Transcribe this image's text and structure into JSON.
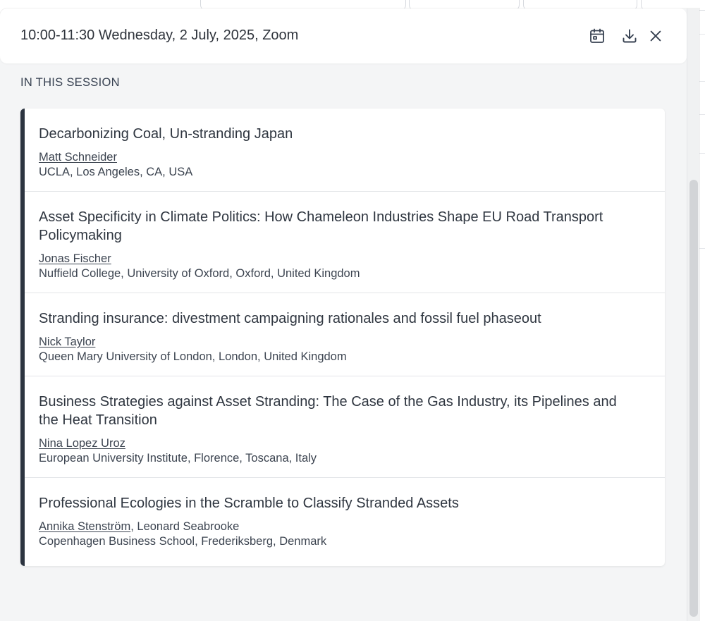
{
  "modal": {
    "title": "10:00-11:30 Wednesday, 2 July, 2025, Zoom",
    "section_label": "IN THIS SESSION",
    "icons": {
      "calendar": "calendar-icon",
      "download": "download-icon",
      "close": "close-icon"
    }
  },
  "colors": {
    "accent_bar": "#2c3440",
    "text": "#374151",
    "background": "#f4f5f6"
  },
  "papers": [
    {
      "title": "Decarbonizing Coal, Un-stranding Japan",
      "authors_linked": "Matt Schneider",
      "authors_rest": "",
      "affiliation": "UCLA, Los Angeles, CA, USA"
    },
    {
      "title": "Asset Specificity in Climate Politics: How Chameleon Industries Shape EU Road Transport Policymaking",
      "authors_linked": "Jonas Fischer",
      "authors_rest": "",
      "affiliation": "Nuffield College, University of Oxford, Oxford, United Kingdom"
    },
    {
      "title": "Stranding insurance: divestment campaigning rationales and fossil fuel phaseout",
      "authors_linked": "Nick Taylor",
      "authors_rest": "",
      "affiliation": "Queen Mary University of London, London, United Kingdom"
    },
    {
      "title": "Business Strategies against Asset Stranding: The Case of the Gas Industry, its Pipelines and the Heat Transition",
      "authors_linked": "Nina Lopez Uroz",
      "authors_rest": "",
      "affiliation": "European University Institute, Florence, Toscana, Italy"
    },
    {
      "title": "Professional Ecologies in the Scramble to Classify Stranded Assets",
      "authors_linked": "Annika Stenström",
      "authors_rest": ", Leonard Seabrooke",
      "affiliation": "Copenhagen Business School, Frederiksberg, Denmark"
    }
  ]
}
